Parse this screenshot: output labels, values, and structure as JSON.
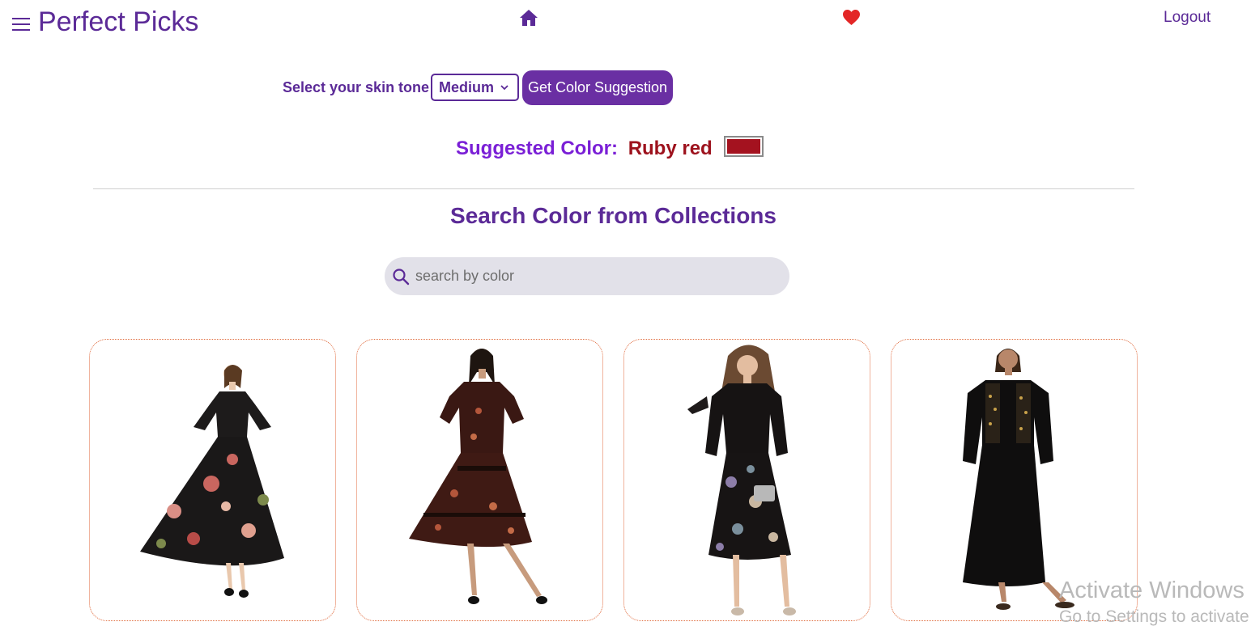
{
  "header": {
    "brand": "Perfect Picks",
    "logout_label": "Logout",
    "icons": {
      "menu": "menu-icon",
      "home": "home-icon",
      "favorites": "heart-icon"
    }
  },
  "skin_tone": {
    "label": "Select your skin tone",
    "selected": "Medium",
    "button_label": "Get Color Suggestion"
  },
  "suggestion": {
    "label": "Suggested Color:",
    "color_name": "Ruby red",
    "swatch_color": "#a4121f"
  },
  "search": {
    "title": "Search Color from Collections",
    "placeholder": "search by color"
  },
  "products": [
    {
      "name": "product-card-1"
    },
    {
      "name": "product-card-2"
    },
    {
      "name": "product-card-3"
    },
    {
      "name": "product-card-4"
    }
  ],
  "watermark": {
    "line1": "Activate Windows",
    "line2": "Go to Settings to activate"
  },
  "colors": {
    "primary": "#5b2a97",
    "button": "#6a2fa3",
    "heart": "#e32626",
    "card_border": "#e06a3c"
  }
}
